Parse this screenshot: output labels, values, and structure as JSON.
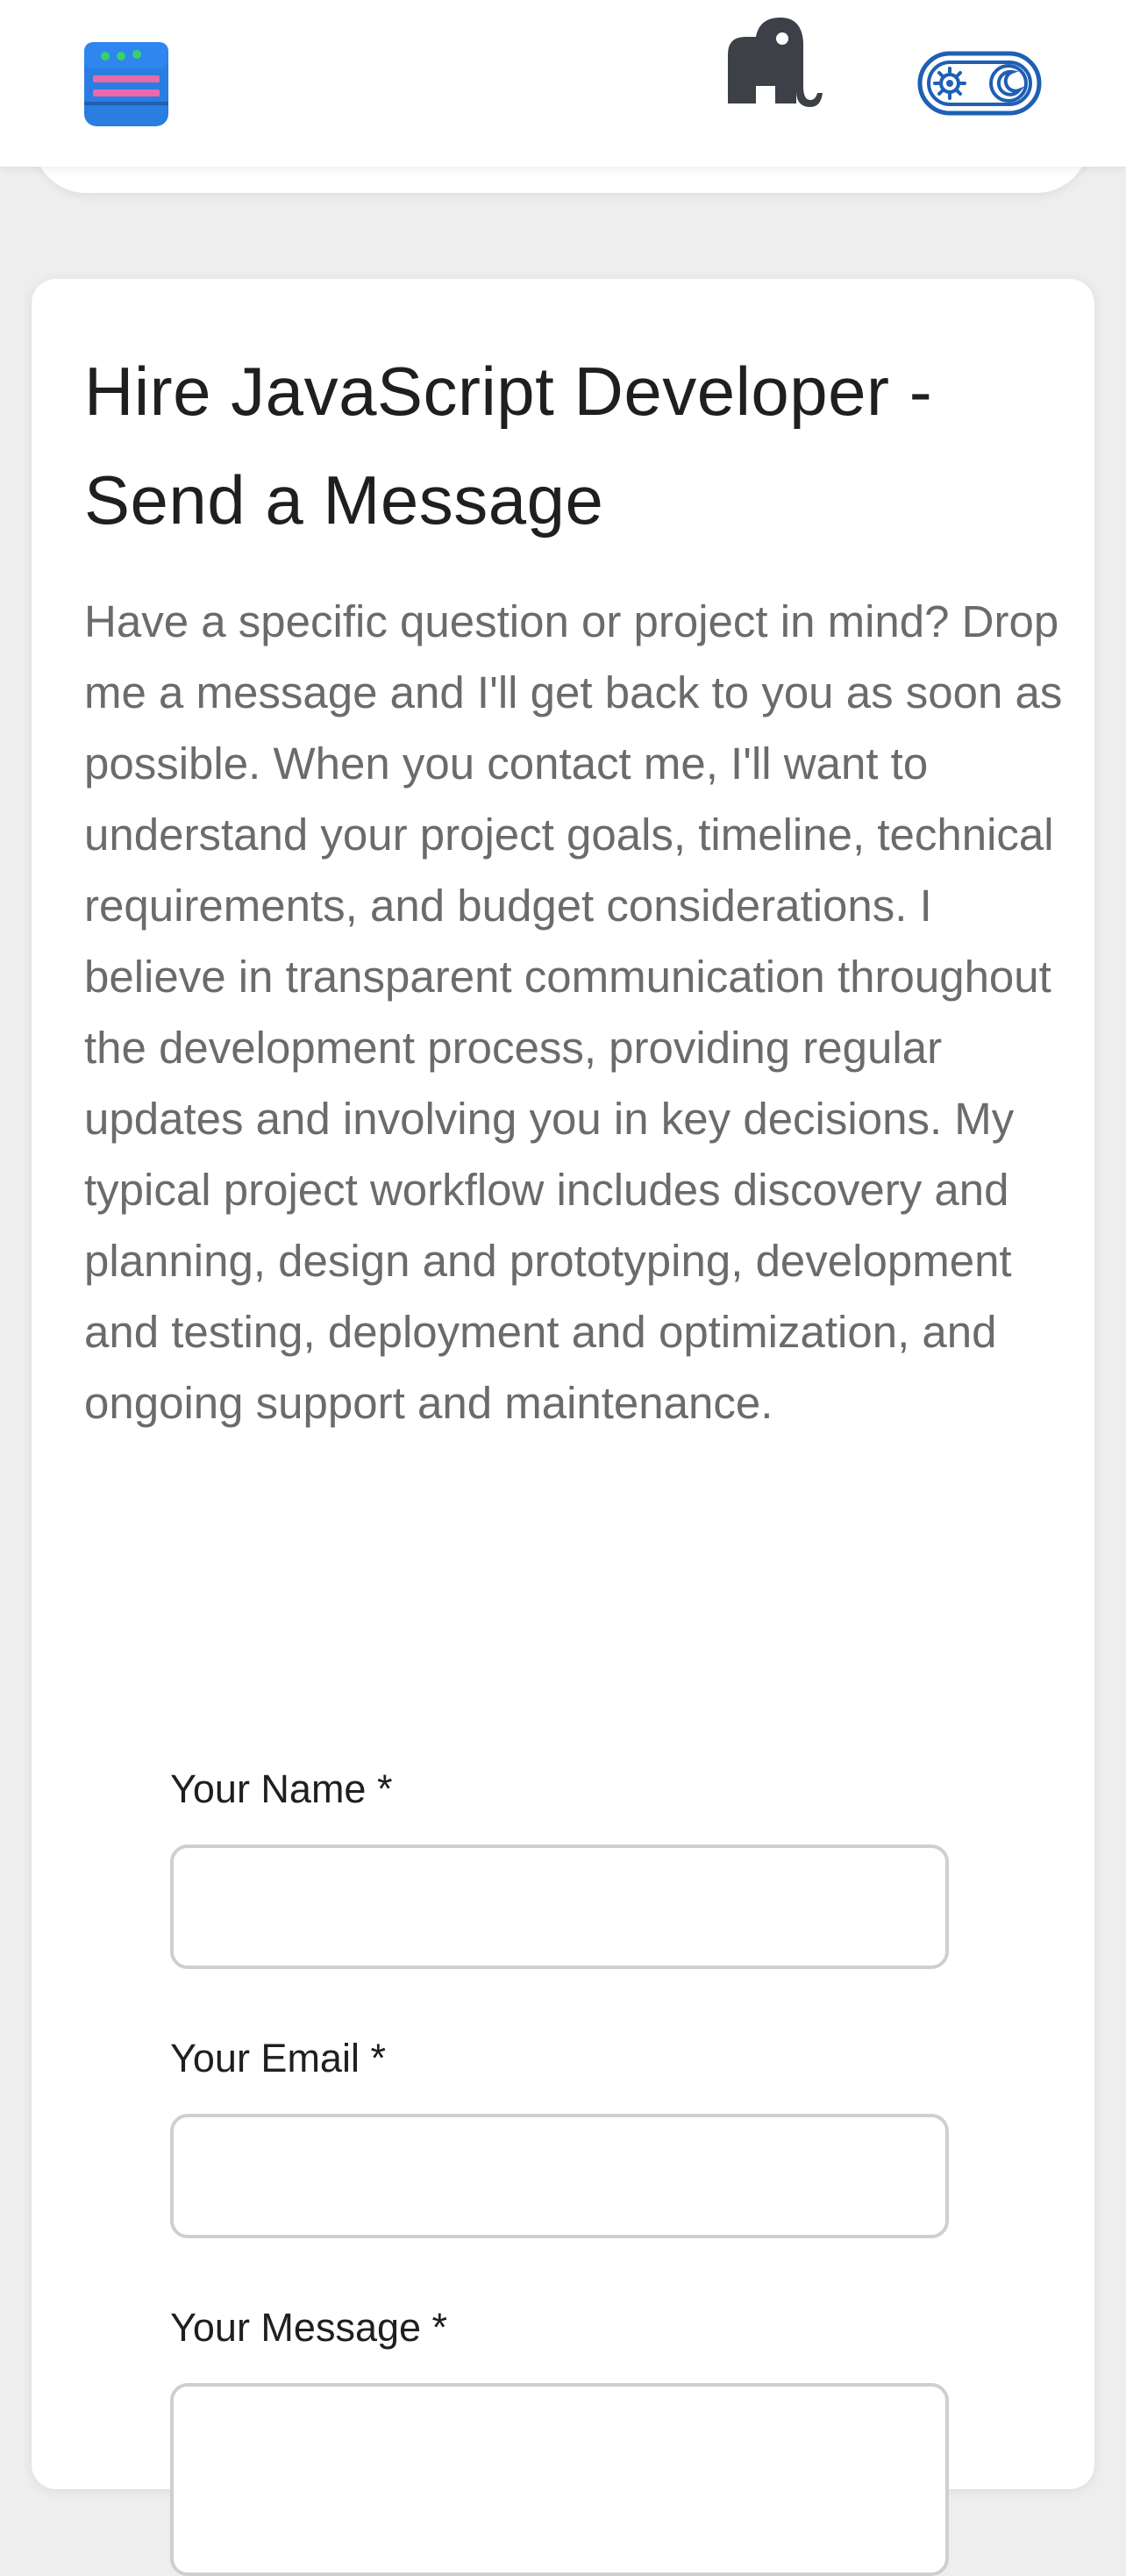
{
  "header": {
    "logo_icon": "server-stack-icon",
    "mascot_icon": "elephant-icon",
    "theme_toggle_icons": [
      "gear-icon",
      "moon-icon"
    ],
    "colors": {
      "logo_blue": "#2a7de1",
      "logo_pink": "#e86aa8",
      "logo_green": "#36d36a",
      "toggle_blue": "#1f5fb4",
      "elephant_gray": "#3d4047"
    }
  },
  "card": {
    "title": "Hire JavaScript Developer - Send a Message",
    "description": "Have a specific question or project in mind? Drop me a message and I'll get back to you as soon as possible. When you contact me, I'll want to understand your project goals, timeline, technical requirements, and budget considerations. I believe in transparent communication throughout the development process, providing regular updates and involving you in key decisions. My typical project workflow includes discovery and planning, design and prototyping, development and testing, deployment and optimization, and ongoing support and maintenance."
  },
  "form": {
    "name_label": "Your Name *",
    "name_value": "",
    "email_label": "Your Email *",
    "email_value": "",
    "message_label": "Your Message *",
    "message_value": ""
  }
}
